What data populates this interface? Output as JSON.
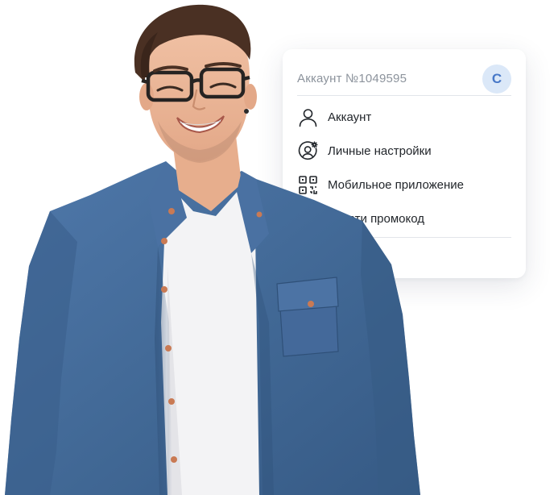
{
  "account_menu": {
    "account_number": "Аккаунт №1049595",
    "avatar_letter": "С",
    "items": [
      {
        "label": "Аккаунт",
        "icon": "user-icon"
      },
      {
        "label": "Личные настройки",
        "icon": "user-settings-icon"
      },
      {
        "label": "Мобильное приложение",
        "icon": "qr-code-icon"
      },
      {
        "label": "Ввести промокод",
        "icon": "promo-icon"
      }
    ]
  },
  "colors": {
    "avatar_bg": "#dbe8f8",
    "avatar_text": "#4778c8",
    "shirt": "#42699a",
    "tshirt": "#f4f4f6",
    "text_primary": "#22262b",
    "text_muted": "#8c939c"
  }
}
